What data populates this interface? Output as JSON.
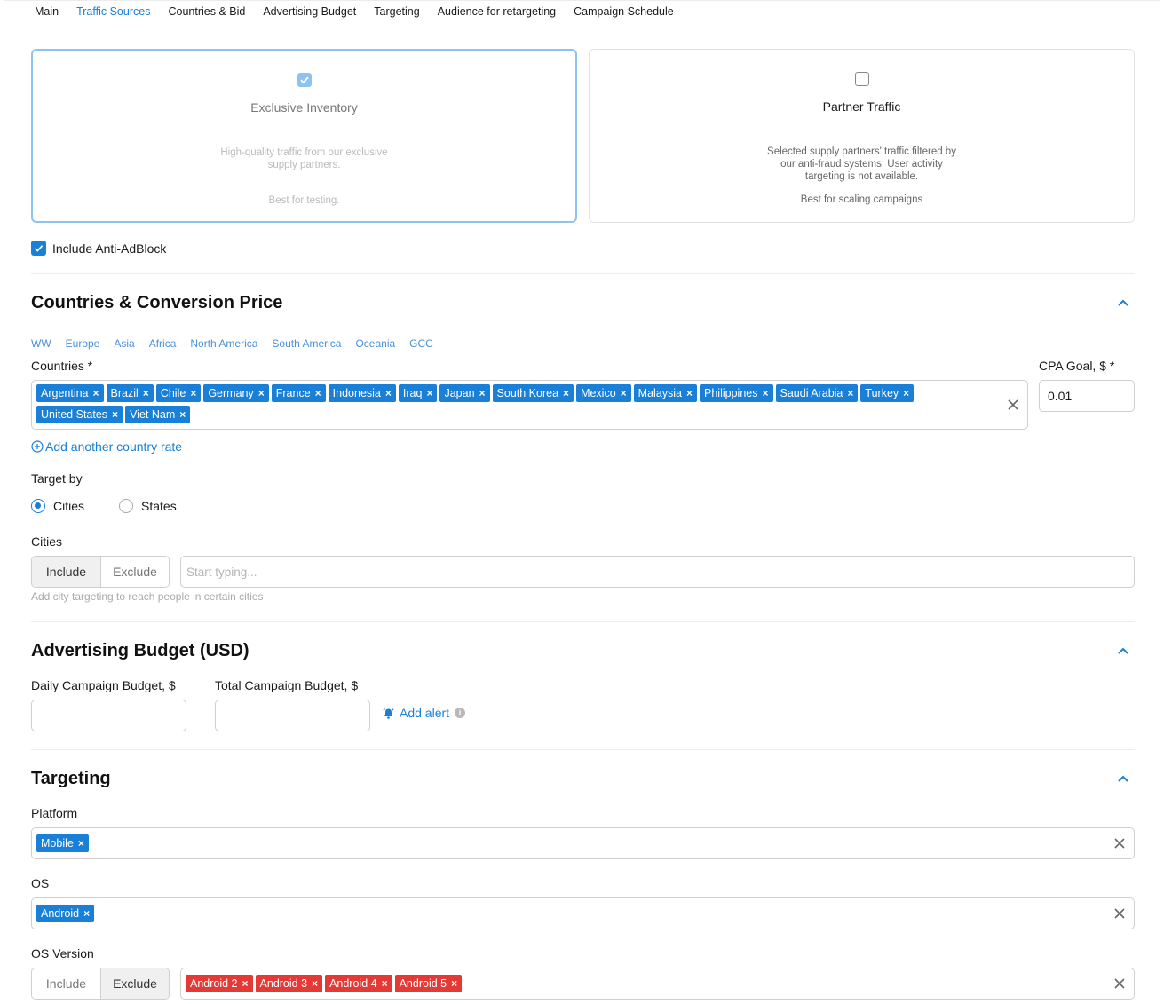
{
  "nav": {
    "items": [
      {
        "label": "Main"
      },
      {
        "label": "Traffic Sources"
      },
      {
        "label": "Countries & Bid"
      },
      {
        "label": "Advertising Budget"
      },
      {
        "label": "Targeting"
      },
      {
        "label": "Audience for retargeting"
      },
      {
        "label": "Campaign Schedule"
      }
    ],
    "active": "Traffic Sources"
  },
  "sources": {
    "exclusive": {
      "title": "Exclusive Inventory",
      "description": "High-quality traffic from our exclusive supply partners.",
      "best": "Best for testing.",
      "checked": true
    },
    "partner": {
      "title": "Partner Traffic",
      "description": "Selected supply partners' traffic filtered by our anti-fraud systems. User activity targeting is not available.",
      "best": "Best for scaling campaigns",
      "checked": false
    }
  },
  "anti_adblock": {
    "label": "Include Anti-AdBlock",
    "checked": true
  },
  "countries_section": {
    "title": "Countries & Conversion Price",
    "regions": [
      "WW",
      "Europe",
      "Asia",
      "Africa",
      "North America",
      "South America",
      "Oceania",
      "GCC"
    ],
    "countries_label": "Countries *",
    "countries": [
      "Argentina",
      "Brazil",
      "Chile",
      "Germany",
      "France",
      "Indonesia",
      "Iraq",
      "Japan",
      "South Korea",
      "Mexico",
      "Malaysia",
      "Philippines",
      "Saudi Arabia",
      "Turkey",
      "United States",
      "Viet Nam"
    ],
    "cpa_label": "CPA Goal, $ *",
    "cpa_value": "0.01",
    "add_rate": "Add another country rate",
    "target_by_label": "Target by",
    "target_options": [
      "Cities",
      "States"
    ],
    "target_selected": "Cities",
    "cities_label": "Cities",
    "include_label": "Include",
    "exclude_label": "Exclude",
    "cities_mode": "Include",
    "cities_placeholder": "Start typing...",
    "cities_hint": "Add city targeting to reach people in certain cities"
  },
  "budget_section": {
    "title": "Advertising Budget (USD)",
    "daily_label": "Daily Campaign Budget, $",
    "daily_value": "",
    "total_label": "Total Campaign Budget, $",
    "total_value": "",
    "add_alert": "Add alert"
  },
  "targeting_section": {
    "title": "Targeting",
    "platform_label": "Platform",
    "platform_tags": [
      "Mobile"
    ],
    "os_label": "OS",
    "os_tags": [
      "Android"
    ],
    "os_version_label": "OS Version",
    "os_version_mode": "Exclude",
    "os_version_include": "Include",
    "os_version_exclude": "Exclude",
    "os_version_tags": [
      "Android 2",
      "Android 3",
      "Android 4",
      "Android 5"
    ]
  },
  "colors": {
    "accent": "#1a7fd6",
    "exclude_tag": "#e53935",
    "selected_card_border": "#8fc3ef"
  }
}
